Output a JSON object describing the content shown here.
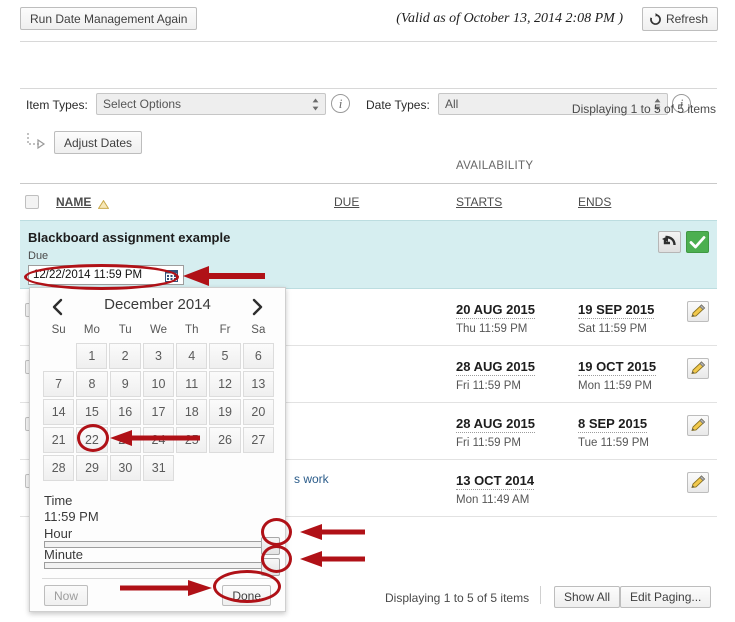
{
  "toolbar": {
    "run_again_label": "Run Date Management Again",
    "valid_as_of": "(Valid as of October 13, 2014 2:08 PM )",
    "refresh_label": "Refresh",
    "refresh_icon": "refresh-icon"
  },
  "filters": {
    "item_types_label": "Item Types:",
    "item_types_value": "Select Options",
    "date_types_label": "Date Types:",
    "date_types_value": "All",
    "info_icon": "info-icon"
  },
  "paging": {
    "displaying_top": "Displaying 1 to 5 of 5 items",
    "displaying_bottom": "Displaying 1 to 5 of 5 items",
    "show_all_label": "Show All",
    "edit_paging_label": "Edit Paging..."
  },
  "actions": {
    "adjust_dates_label": "Adjust Dates",
    "adjust_arrow_icon": "dashed-arrow-icon"
  },
  "table": {
    "availability_group": "AVAILABILITY",
    "columns": {
      "name": "NAME",
      "due": "DUE",
      "starts": "STARTS",
      "ends": "ENDS"
    },
    "sort_icon": "sort-ascending-caret-icon",
    "edit_row": {
      "title": "Blackboard assignment example",
      "due_label": "Due",
      "date_value": "12/22/2014 11:59 PM",
      "calendar_icon": "calendar-icon",
      "revert_icon": "undo-arrow-icon",
      "confirm_icon": "checkmark-icon"
    },
    "rows": [
      {
        "name": "",
        "due_date": "",
        "due_time": "",
        "starts_date": "20 AUG 2015",
        "starts_time": "Thu 11:59 PM",
        "ends_date": "19 SEP 2015",
        "ends_time": "Sat 11:59 PM",
        "edit_icon": "pencil-icon"
      },
      {
        "name": "",
        "due_date": "",
        "due_time": "",
        "starts_date": "28 AUG 2015",
        "starts_time": "Fri 11:59 PM",
        "ends_date": "19 OCT 2015",
        "ends_time": "Mon 11:59 PM",
        "edit_icon": "pencil-icon"
      },
      {
        "name": "",
        "due_date": "",
        "due_time": "",
        "starts_date": "28 AUG 2015",
        "starts_time": "Fri 11:59 PM",
        "ends_date": "8 SEP 2015",
        "ends_time": "Tue 11:59 PM",
        "edit_icon": "pencil-icon"
      },
      {
        "name": "s work",
        "due_date": "",
        "due_time": "",
        "starts_date": "13 OCT 2014",
        "starts_time": "Mon 11:49 AM",
        "ends_date": "",
        "ends_time": "",
        "edit_icon": "pencil-icon"
      }
    ]
  },
  "datepicker": {
    "prev_icon": "chevron-left-icon",
    "next_icon": "chevron-right-icon",
    "title": "December 2014",
    "daynames": [
      "Su",
      "Mo",
      "Tu",
      "We",
      "Th",
      "Fr",
      "Sa"
    ],
    "weeks": [
      [
        "",
        "1",
        "2",
        "3",
        "4",
        "5",
        "6"
      ],
      [
        "7",
        "8",
        "9",
        "10",
        "11",
        "12",
        "13"
      ],
      [
        "14",
        "15",
        "16",
        "17",
        "18",
        "19",
        "20"
      ],
      [
        "21",
        "22",
        "23",
        "24",
        "25",
        "26",
        "27"
      ],
      [
        "28",
        "29",
        "30",
        "31",
        "",
        "",
        ""
      ]
    ],
    "selected_day": "22",
    "time_label": "Time",
    "time_value": "11:59 PM",
    "hour_label": "Hour",
    "minute_label": "Minute",
    "now_label": "Now",
    "done_label": "Done"
  },
  "annotations": {
    "highlight_color": "#b01117",
    "targets": [
      "date-input-field",
      "calendar-day-22",
      "hour-slider-knob",
      "minute-slider-knob",
      "done-button"
    ]
  }
}
